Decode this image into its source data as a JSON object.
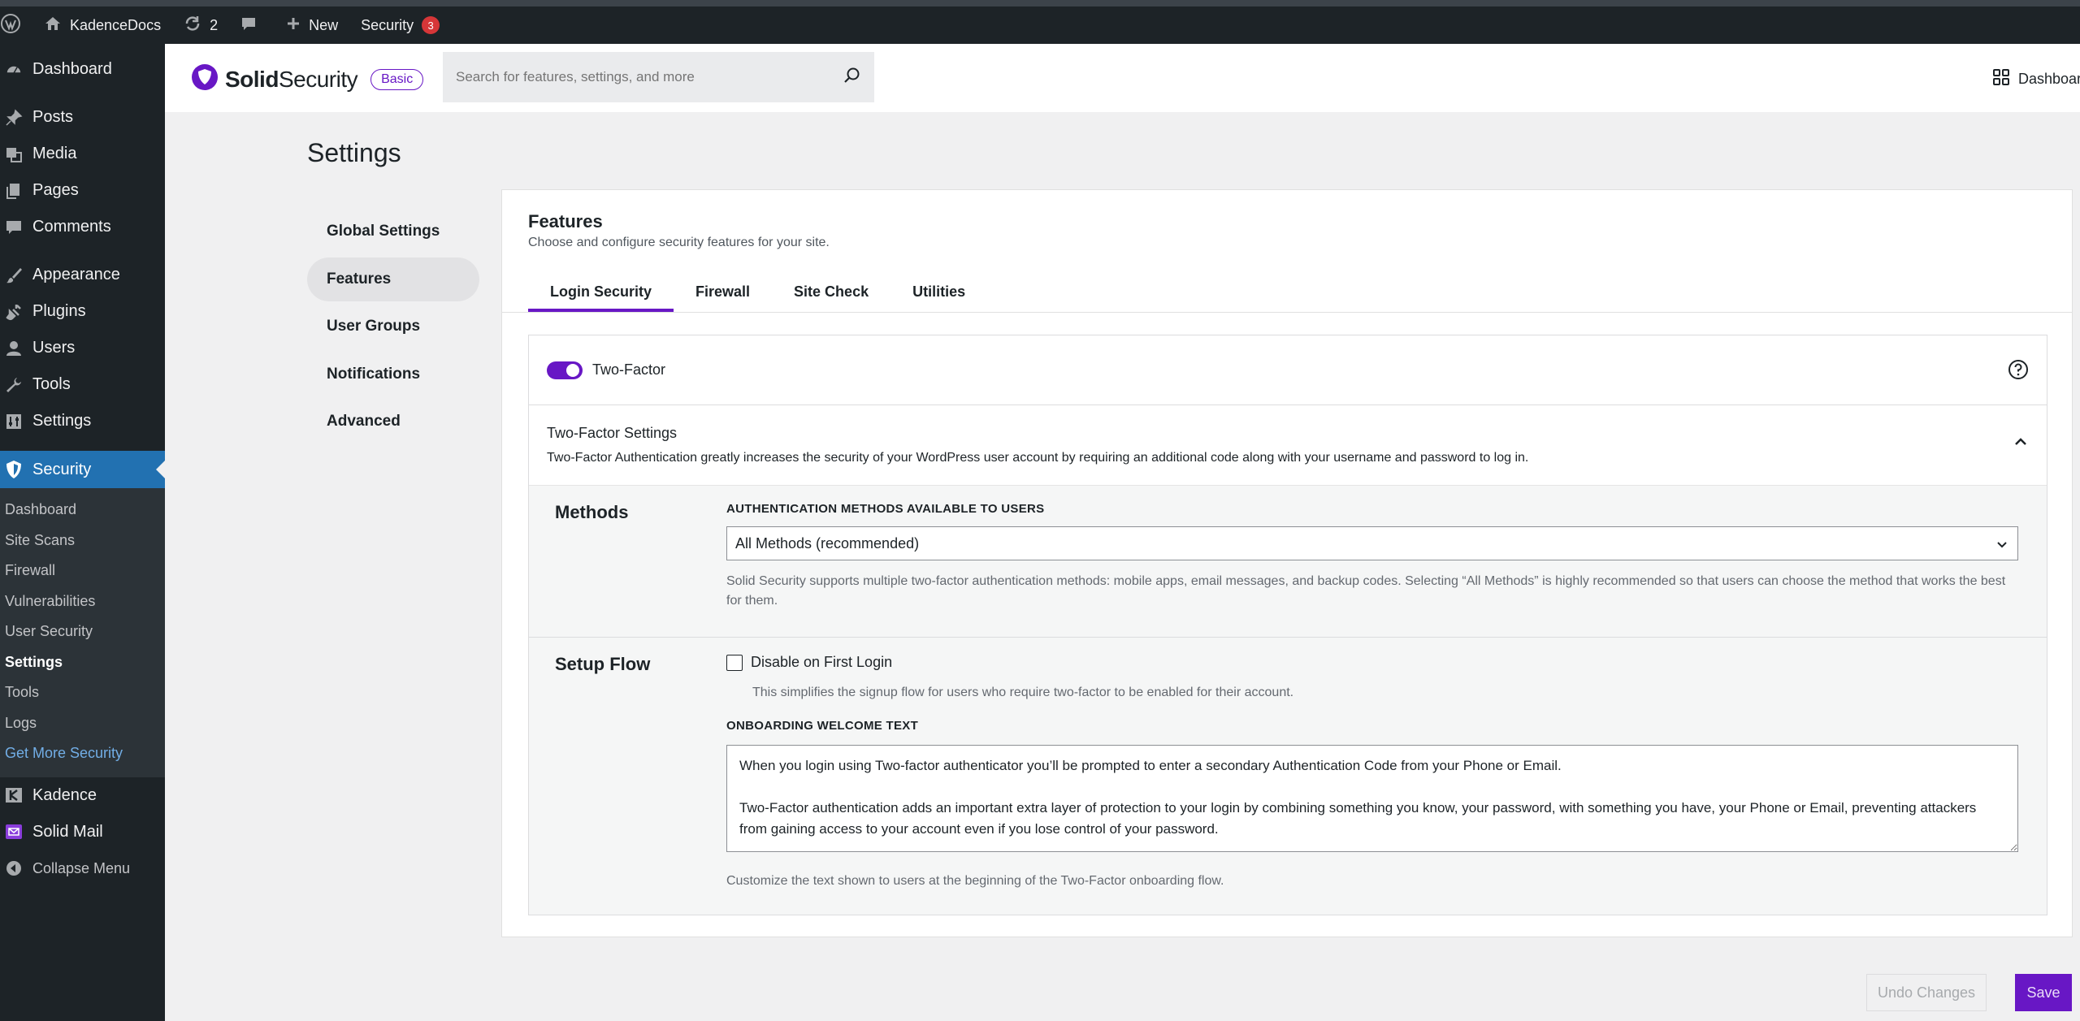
{
  "colors": {
    "accent": "#6817c5",
    "wp_blue": "#2271b1",
    "admin_bg": "#1d2327",
    "badge": "#d63638"
  },
  "adminbar": {
    "site_name": "KadenceDocs",
    "updates_count": "2",
    "new_label": "New",
    "security_label": "Security",
    "security_badge": "3"
  },
  "sidebar": {
    "items_top": [
      {
        "label": "Dashboard",
        "icon": "dashboard-icon"
      },
      {
        "label": "Posts",
        "icon": "pin-icon"
      },
      {
        "label": "Media",
        "icon": "media-icon"
      },
      {
        "label": "Pages",
        "icon": "pages-icon"
      },
      {
        "label": "Comments",
        "icon": "comment-icon"
      },
      {
        "label": "Appearance",
        "icon": "brush-icon"
      },
      {
        "label": "Plugins",
        "icon": "plug-icon"
      },
      {
        "label": "Users",
        "icon": "user-icon"
      },
      {
        "label": "Tools",
        "icon": "wrench-icon"
      },
      {
        "label": "Settings",
        "icon": "sliders-icon"
      }
    ],
    "security": {
      "label": "Security",
      "icon": "shield-icon"
    },
    "security_sub": [
      "Dashboard",
      "Site Scans",
      "Firewall",
      "Vulnerabilities",
      "User Security",
      "Settings",
      "Tools",
      "Logs",
      "Get More Security"
    ],
    "items_bottom": [
      {
        "label": "Kadence",
        "icon": "kadence-icon"
      },
      {
        "label": "Solid Mail",
        "icon": "mail-icon"
      }
    ],
    "collapse_label": "Collapse Menu"
  },
  "header": {
    "logo_bold": "Solid",
    "logo_rest": "Security",
    "plan_badge": "Basic",
    "search_placeholder": "Search for features, settings, and more",
    "dashboard_link": "Dashboard"
  },
  "page": {
    "title": "Settings"
  },
  "settings_nav": [
    "Global Settings",
    "Features",
    "User Groups",
    "Notifications",
    "Advanced"
  ],
  "panel": {
    "title": "Features",
    "description": "Choose and configure security features for your site.",
    "tabs": [
      "Login Security",
      "Firewall",
      "Site Check",
      "Utilities"
    ]
  },
  "module": {
    "toggle_label": "Two-Factor",
    "toggle_on": true,
    "settings_title": "Two-Factor Settings",
    "settings_desc": "Two-Factor Authentication greatly increases the security of your WordPress user account by requiring an additional code along with your username and password to log in.",
    "methods": {
      "title": "Methods",
      "field_label": "AUTHENTICATION METHODS AVAILABLE TO USERS",
      "selected": "All Methods (recommended)",
      "help": "Solid Security supports multiple two-factor authentication methods: mobile apps, email messages, and backup codes. Selecting “All Methods” is highly recommended so that users can choose the method that works the best for them."
    },
    "setup": {
      "title": "Setup Flow",
      "checkbox_label": "Disable on First Login",
      "checkbox_checked": false,
      "checkbox_help": "This simplifies the signup flow for users who require two-factor to be enabled for their account.",
      "welcome_label": "ONBOARDING WELCOME TEXT",
      "welcome_text": "When you login using Two-factor authenticator you’ll be prompted to enter a secondary Authentication Code from your Phone or Email.\n\nTwo-Factor authentication adds an important extra layer of protection to your login by combining something you know, your password, with something you have, your Phone or Email, preventing attackers from gaining access to your account even if you lose control of your password.",
      "welcome_help": "Customize the text shown to users at the beginning of the Two-Factor onboarding flow."
    }
  },
  "footer": {
    "undo_label": "Undo Changes",
    "save_label": "Save"
  }
}
